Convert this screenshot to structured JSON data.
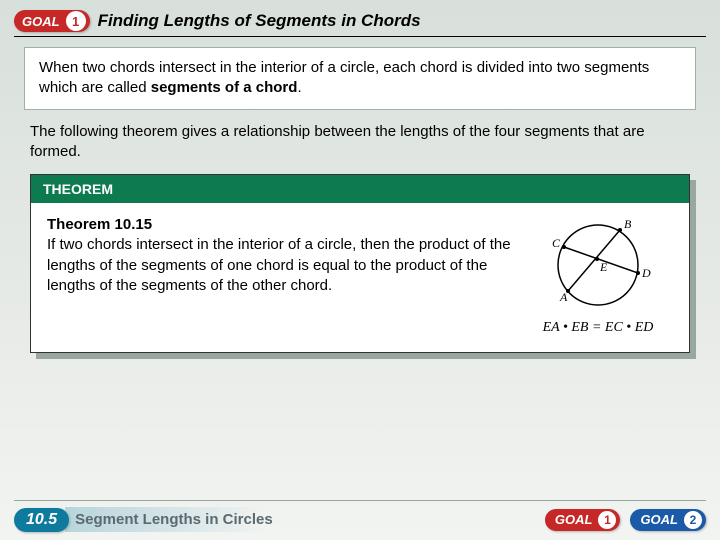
{
  "header": {
    "goal_label": "GOAL",
    "goal_num": "1",
    "title": "Finding Lengths of Segments in Chords"
  },
  "intro": {
    "text_a": "When two chords intersect in the interior of a circle, each chord is divided into two segments which are called ",
    "term": "segments of a chord",
    "text_b": "."
  },
  "mid": "The following theorem gives a relationship between the lengths of the four segments that are formed.",
  "theorem": {
    "heading": "THEOREM",
    "name": "Theorem 10.15",
    "body": "If two chords intersect in the interior of a circle, then the product of the lengths of the segments of one chord is equal to the product of the lengths of the segments of the other chord.",
    "labels": {
      "A": "A",
      "B": "B",
      "C": "C",
      "D": "D",
      "E": "E"
    },
    "equation": "EA • EB = EC • ED"
  },
  "footer": {
    "section_num": "10.5",
    "section_title": "Segment Lengths in Circles",
    "goal_label": "GOAL",
    "g1": "1",
    "g2": "2"
  }
}
